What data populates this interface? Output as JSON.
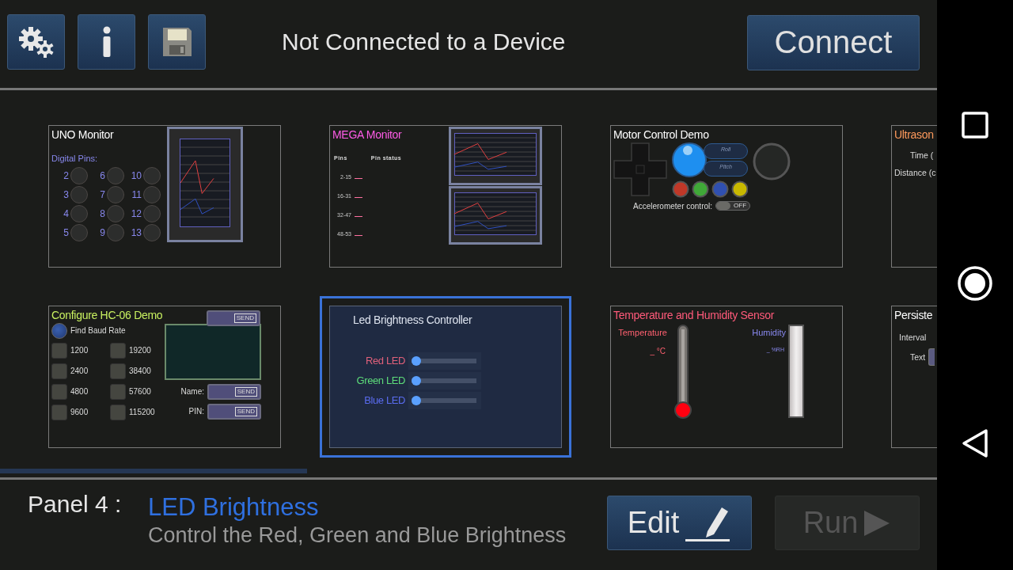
{
  "toolbar": {
    "buttons": [
      {
        "kind": "settings"
      },
      {
        "kind": "info"
      },
      {
        "kind": "save"
      }
    ],
    "status": "Not Connected to a Device",
    "connect_button": "Connect"
  },
  "panels": [
    {
      "kind": "uno",
      "title": "UNO Monitor",
      "color": "#ffffff",
      "selected": false,
      "subtitle": "Digital Pins:",
      "pins": [
        "2",
        "3",
        "4",
        "5",
        "6",
        "7",
        "8",
        "9",
        "10",
        "11",
        "12",
        "13"
      ]
    },
    {
      "kind": "mega",
      "title": "MEGA Monitor",
      "color": "#ff5ce8",
      "selected": false,
      "headers": [
        "Pins",
        "Pin status"
      ],
      "rows": [
        "2-15",
        "16-31",
        "32-47",
        "48-53"
      ]
    },
    {
      "kind": "motor",
      "title": "Motor Control Demo",
      "color": "#ffffff",
      "selected": false,
      "pills": [
        "Roll",
        "Pitch"
      ],
      "toggle_label": "Accelerometer control:",
      "toggle": {
        "text": "OFF",
        "on": false
      }
    },
    {
      "kind": "ultrasonic",
      "title": "Ultrason",
      "color": "#ff9a5c",
      "selected": false,
      "fields": [
        "Time (",
        "Distance (c"
      ]
    },
    {
      "kind": "hc06",
      "title": "Configure HC-06 Demo",
      "color": "#c8f060",
      "selected": false,
      "sends": [
        "SEND",
        "SEND",
        "SEND"
      ],
      "radio": "Find Baud Rate",
      "rates": [
        "1200",
        "2400",
        "4800",
        "9600",
        "19200",
        "38400",
        "57600",
        "115200"
      ],
      "name_label": "Name:",
      "pin_label": "PIN:"
    },
    {
      "kind": "led",
      "title": "Led Brightness Controller",
      "color": "#dde3ee",
      "selected": true,
      "sliders": [
        {
          "label": "Red LED",
          "color": "#e0607a",
          "level": 0
        },
        {
          "label": "Green LED",
          "color": "#5ddc7a",
          "level": 0
        },
        {
          "label": "Blue LED",
          "color": "#5a6cf0",
          "level": 0
        }
      ]
    },
    {
      "kind": "temp",
      "title": "Temperature and Humidity Sensor",
      "color": "#ff5a7a",
      "selected": false,
      "temp_label": "Temperature",
      "temp_value": "_ °C",
      "hum_label": "Humidity",
      "hum_value": "_ %RH"
    },
    {
      "kind": "persist",
      "title": "Persiste",
      "color": "#ffffff",
      "selected": false,
      "fields": [
        "Interval",
        "Text"
      ]
    }
  ],
  "footer": {
    "label": "Panel 4 :",
    "name": "LED Brightness",
    "description": "Control the Red, Green and Blue Brightness",
    "edit_button": "Edit",
    "run_button": {
      "text": "Run",
      "disabled": true
    }
  }
}
